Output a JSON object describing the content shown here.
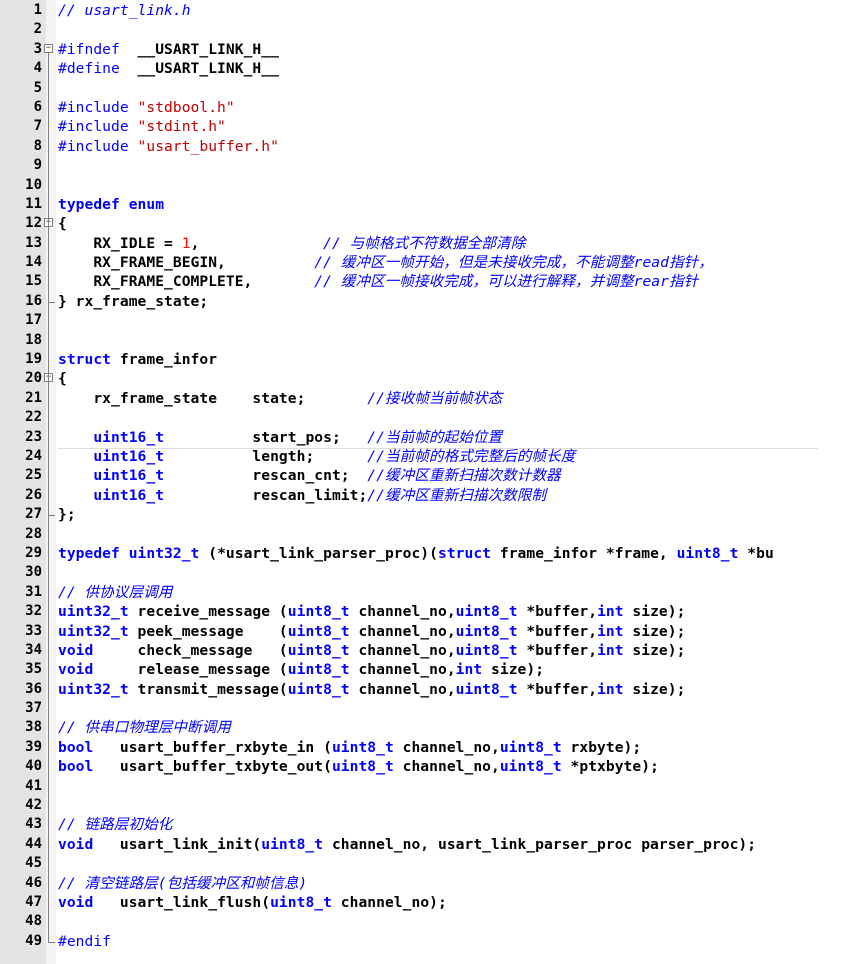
{
  "editor": {
    "file_comment": "// usart_link.h",
    "colors": {
      "comment": "#0000ff",
      "keyword": "#0000ff",
      "string": "#c00000",
      "number": "#ff0000",
      "gutter_bg": "#e4e4e4"
    },
    "folds": {
      "3": "⊟",
      "12": "⊟",
      "20": "⊟"
    },
    "fold_ends": [
      "16",
      "27",
      "49"
    ],
    "lines": [
      [
        {
          "t": "// usart_link.h",
          "c": "comment"
        }
      ],
      [],
      [
        {
          "t": "#ifndef  ",
          "c": "preproc"
        },
        {
          "t": "__USART_LINK_H__",
          "c": "bold"
        }
      ],
      [
        {
          "t": "#define  ",
          "c": "preproc"
        },
        {
          "t": "__USART_LINK_H__",
          "c": "bold"
        }
      ],
      [],
      [
        {
          "t": "#include ",
          "c": "preproc"
        },
        {
          "t": "\"stdbool.h\"",
          "c": "string"
        }
      ],
      [
        {
          "t": "#include ",
          "c": "preproc"
        },
        {
          "t": "\"stdint.h\"",
          "c": "string"
        }
      ],
      [
        {
          "t": "#include ",
          "c": "preproc"
        },
        {
          "t": "\"usart_buffer.h\"",
          "c": "string"
        }
      ],
      [],
      [],
      [
        {
          "t": "typedef enum",
          "c": "keyword"
        }
      ],
      [
        {
          "t": "{",
          "c": "bold"
        }
      ],
      [
        {
          "t": "    RX_IDLE = ",
          "c": "bold"
        },
        {
          "t": "1",
          "c": "number"
        },
        {
          "t": ",              ",
          "c": "bold"
        },
        {
          "t": "// 与帧格式不符数据全部清除",
          "c": "comment"
        }
      ],
      [
        {
          "t": "    RX_FRAME_BEGIN,          ",
          "c": "bold"
        },
        {
          "t": "// 缓冲区一帧开始，但是未接收完成，不能调整read指针，",
          "c": "comment"
        }
      ],
      [
        {
          "t": "    RX_FRAME_COMPLETE,       ",
          "c": "bold"
        },
        {
          "t": "// 缓冲区一帧接收完成，可以进行解释，并调整rear指针",
          "c": "comment"
        }
      ],
      [
        {
          "t": "} rx_frame_state;",
          "c": "bold"
        }
      ],
      [],
      [],
      [
        {
          "t": "struct ",
          "c": "keyword"
        },
        {
          "t": "frame_infor",
          "c": "bold"
        }
      ],
      [
        {
          "t": "{",
          "c": "bold"
        }
      ],
      [
        {
          "t": "    rx_frame_state    state;       ",
          "c": "bold"
        },
        {
          "t": "//接收帧当前帧状态",
          "c": "comment"
        }
      ],
      [],
      [
        {
          "t": "    ",
          "c": "bold"
        },
        {
          "t": "uint16_t",
          "c": "type"
        },
        {
          "t": "          start_pos;   ",
          "c": "bold"
        },
        {
          "t": "//当前帧的起始位置",
          "c": "comment"
        }
      ],
      [
        {
          "t": "    ",
          "c": "bold"
        },
        {
          "t": "uint16_t",
          "c": "type"
        },
        {
          "t": "          length;      ",
          "c": "bold"
        },
        {
          "t": "//当前帧的格式完整后的帧长度",
          "c": "comment"
        }
      ],
      [
        {
          "t": "    ",
          "c": "bold"
        },
        {
          "t": "uint16_t",
          "c": "type"
        },
        {
          "t": "          rescan_cnt;  ",
          "c": "bold"
        },
        {
          "t": "//缓冲区重新扫描次数计数器",
          "c": "comment"
        }
      ],
      [
        {
          "t": "    ",
          "c": "bold"
        },
        {
          "t": "uint16_t",
          "c": "type"
        },
        {
          "t": "          rescan_limit;",
          "c": "bold"
        },
        {
          "t": "//缓冲区重新扫描次数限制",
          "c": "comment"
        }
      ],
      [
        {
          "t": "};",
          "c": "bold"
        }
      ],
      [],
      [
        {
          "t": "typedef ",
          "c": "keyword"
        },
        {
          "t": "uint32_t",
          "c": "type"
        },
        {
          "t": " (*usart_link_parser_proc)(",
          "c": "bold"
        },
        {
          "t": "struct",
          "c": "keyword"
        },
        {
          "t": " frame_infor *frame, ",
          "c": "bold"
        },
        {
          "t": "uint8_t",
          "c": "type"
        },
        {
          "t": " *bu",
          "c": "bold"
        }
      ],
      [],
      [
        {
          "t": "// 供协议层调用",
          "c": "comment"
        }
      ],
      [
        {
          "t": "uint32_t",
          "c": "type"
        },
        {
          "t": " receive_message (",
          "c": "bold"
        },
        {
          "t": "uint8_t",
          "c": "type"
        },
        {
          "t": " channel_no,",
          "c": "bold"
        },
        {
          "t": "uint8_t",
          "c": "type"
        },
        {
          "t": " *buffer,",
          "c": "bold"
        },
        {
          "t": "int",
          "c": "type"
        },
        {
          "t": " size);",
          "c": "bold"
        }
      ],
      [
        {
          "t": "uint32_t",
          "c": "type"
        },
        {
          "t": " peek_message    (",
          "c": "bold"
        },
        {
          "t": "uint8_t",
          "c": "type"
        },
        {
          "t": " channel_no,",
          "c": "bold"
        },
        {
          "t": "uint8_t",
          "c": "type"
        },
        {
          "t": " *buffer,",
          "c": "bold"
        },
        {
          "t": "int",
          "c": "type"
        },
        {
          "t": " size);",
          "c": "bold"
        }
      ],
      [
        {
          "t": "void",
          "c": "type"
        },
        {
          "t": "     check_message   (",
          "c": "bold"
        },
        {
          "t": "uint8_t",
          "c": "type"
        },
        {
          "t": " channel_no,",
          "c": "bold"
        },
        {
          "t": "uint8_t",
          "c": "type"
        },
        {
          "t": " *buffer,",
          "c": "bold"
        },
        {
          "t": "int",
          "c": "type"
        },
        {
          "t": " size);",
          "c": "bold"
        }
      ],
      [
        {
          "t": "void",
          "c": "type"
        },
        {
          "t": "     release_message (",
          "c": "bold"
        },
        {
          "t": "uint8_t",
          "c": "type"
        },
        {
          "t": " channel_no,",
          "c": "bold"
        },
        {
          "t": "int",
          "c": "type"
        },
        {
          "t": " size);",
          "c": "bold"
        }
      ],
      [
        {
          "t": "uint32_t",
          "c": "type"
        },
        {
          "t": " transmit_message(",
          "c": "bold"
        },
        {
          "t": "uint8_t",
          "c": "type"
        },
        {
          "t": " channel_no,",
          "c": "bold"
        },
        {
          "t": "uint8_t",
          "c": "type"
        },
        {
          "t": " *buffer,",
          "c": "bold"
        },
        {
          "t": "int",
          "c": "type"
        },
        {
          "t": " size);",
          "c": "bold"
        }
      ],
      [],
      [
        {
          "t": "// 供串口物理层中断调用",
          "c": "comment"
        }
      ],
      [
        {
          "t": "bool",
          "c": "type"
        },
        {
          "t": "   usart_buffer_rxbyte_in (",
          "c": "bold"
        },
        {
          "t": "uint8_t",
          "c": "type"
        },
        {
          "t": " channel_no,",
          "c": "bold"
        },
        {
          "t": "uint8_t",
          "c": "type"
        },
        {
          "t": " rxbyte);",
          "c": "bold"
        }
      ],
      [
        {
          "t": "bool",
          "c": "type"
        },
        {
          "t": "   usart_buffer_txbyte_out(",
          "c": "bold"
        },
        {
          "t": "uint8_t",
          "c": "type"
        },
        {
          "t": " channel_no,",
          "c": "bold"
        },
        {
          "t": "uint8_t",
          "c": "type"
        },
        {
          "t": " *ptxbyte);",
          "c": "bold"
        }
      ],
      [],
      [],
      [
        {
          "t": "// 链路层初始化",
          "c": "comment"
        }
      ],
      [
        {
          "t": "void",
          "c": "type"
        },
        {
          "t": "   usart_link_init(",
          "c": "bold"
        },
        {
          "t": "uint8_t",
          "c": "type"
        },
        {
          "t": " channel_no, usart_link_parser_proc parser_proc);",
          "c": "bold"
        }
      ],
      [],
      [
        {
          "t": "// 清空链路层(包括缓冲区和帧信息)",
          "c": "comment"
        }
      ],
      [
        {
          "t": "void",
          "c": "type"
        },
        {
          "t": "   usart_link_flush(",
          "c": "bold"
        },
        {
          "t": "uint8_t",
          "c": "type"
        },
        {
          "t": " channel_no);",
          "c": "bold"
        }
      ],
      [],
      [
        {
          "t": "#endif",
          "c": "preproc"
        }
      ]
    ]
  }
}
